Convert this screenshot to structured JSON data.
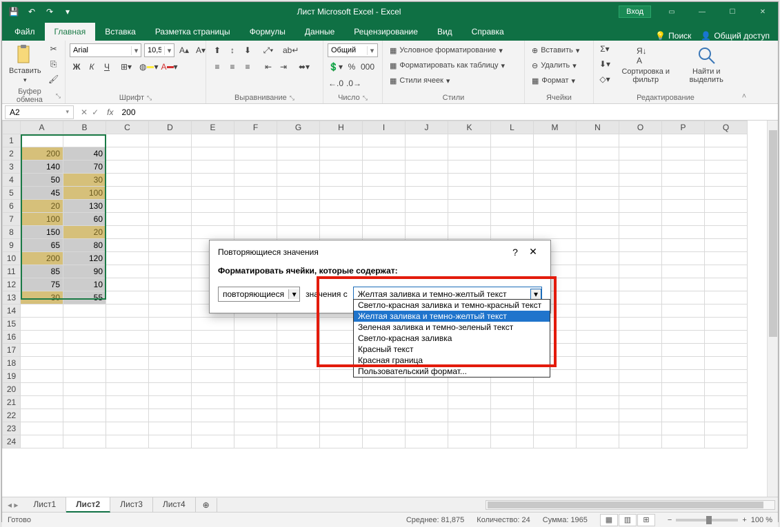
{
  "title": "Лист Microsoft Excel  -  Excel",
  "qat": {
    "save": "💾",
    "undo": "↶",
    "redo": "↷"
  },
  "account_btn": "Вход",
  "tabs": [
    "Файл",
    "Главная",
    "Вставка",
    "Разметка страницы",
    "Формулы",
    "Данные",
    "Рецензирование",
    "Вид",
    "Справка"
  ],
  "active_tab": 1,
  "tell_me": "Поиск",
  "share": "Общий доступ",
  "ribbon": {
    "clipboard": {
      "paste": "Вставить",
      "label": "Буфер обмена"
    },
    "font": {
      "name": "Arial",
      "size": "10,5",
      "bold": "Ж",
      "italic": "К",
      "underline": "Ч",
      "label": "Шрифт"
    },
    "alignment": {
      "wrap": "",
      "merge": "",
      "label": "Выравнивание"
    },
    "number": {
      "format": "Общий",
      "label": "Число"
    },
    "styles": {
      "cond": "Условное форматирование",
      "table": "Форматировать как таблицу",
      "cell": "Стили ячеек",
      "label": "Стили"
    },
    "cells": {
      "insert": "Вставить",
      "delete": "Удалить",
      "format": "Формат",
      "label": "Ячейки"
    },
    "editing": {
      "sort": "Сортировка и фильтр",
      "find": "Найти и выделить",
      "label": "Редактирование"
    }
  },
  "namebox": "A2",
  "formula": "200",
  "columns": [
    "A",
    "B",
    "C",
    "D",
    "E",
    "F",
    "G",
    "H",
    "I",
    "J",
    "K",
    "L",
    "M",
    "N",
    "O",
    "P",
    "Q"
  ],
  "rows": 24,
  "data": {
    "A": [
      null,
      200,
      140,
      50,
      45,
      20,
      100,
      150,
      65,
      200,
      85,
      75,
      30
    ],
    "B": [
      null,
      40,
      70,
      30,
      100,
      130,
      60,
      20,
      80,
      120,
      90,
      10,
      55
    ]
  },
  "yellow_cells": [
    "A2",
    "A6",
    "A7",
    "A10",
    "A13",
    "B4",
    "B5",
    "B8"
  ],
  "sheets": [
    "Лист1",
    "Лист2",
    "Лист3",
    "Лист4"
  ],
  "active_sheet": 1,
  "status": {
    "ready": "Готово",
    "avg_label": "Среднее:",
    "avg": "81,875",
    "count_label": "Количество:",
    "count": "24",
    "sum_label": "Сумма:",
    "sum": "1965",
    "zoom": "100 %"
  },
  "dialog": {
    "title": "Повторяющиеся значения",
    "help": "?",
    "close": "✕",
    "prompt": "Форматировать ячейки, которые содержат:",
    "type_value": "повторяющиеся",
    "with_label": "значения с",
    "format_value": "Желтая заливка и темно-желтый текст",
    "options": [
      "Светло-красная заливка и темно-красный текст",
      "Желтая заливка и темно-желтый текст",
      "Зеленая заливка и темно-зеленый текст",
      "Светло-красная заливка",
      "Красный текст",
      "Красная граница",
      "Пользовательский формат..."
    ],
    "highlighted_option": 1
  }
}
